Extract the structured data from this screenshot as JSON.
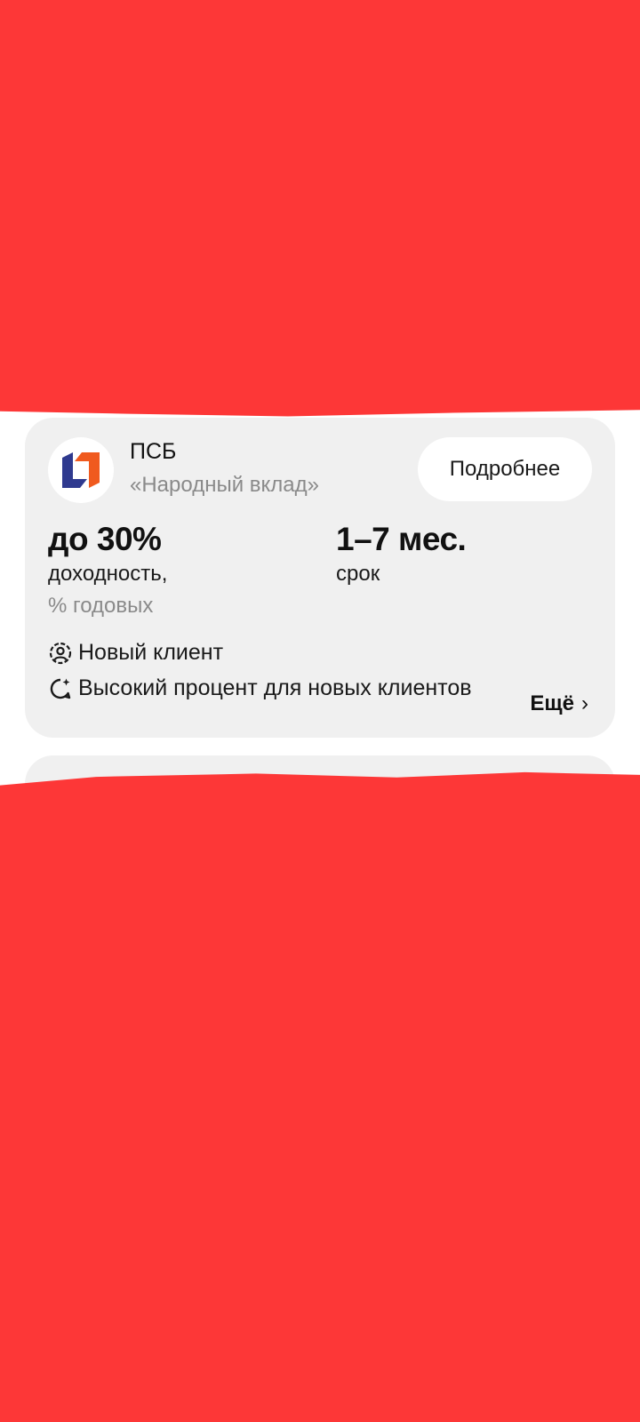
{
  "offer": {
    "bank_name": "ПСБ",
    "product_name": "«Народный вклад»",
    "details_button": "Подробнее",
    "rate": {
      "value": "до 30%",
      "label": "доходность,",
      "sublabel": "% годовых"
    },
    "term": {
      "value": "1–7 мес.",
      "label": "срок"
    },
    "features": [
      {
        "icon": "user-circle-icon",
        "text": "Новый клиент"
      },
      {
        "icon": "chat-sparkle-icon",
        "text": "Высокий процент для новых клиентов"
      }
    ],
    "more_link": "Ещё",
    "more_chevron": "›"
  },
  "colors": {
    "redaction": "#fd3737",
    "card_background": "#f0f0f0",
    "logo_blue": "#2f3a8f",
    "logo_orange": "#f05a1e"
  }
}
